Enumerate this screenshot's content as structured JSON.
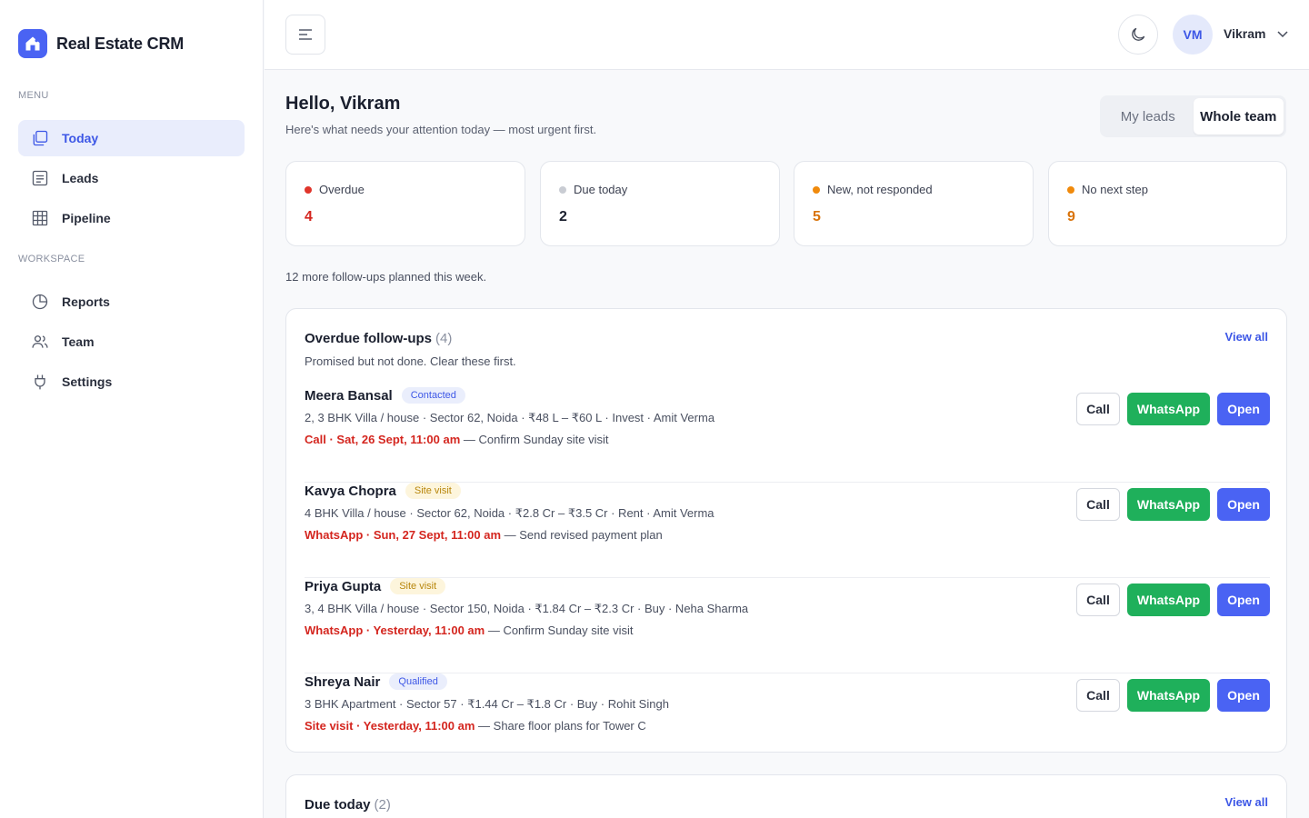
{
  "app": {
    "title": "Real Estate CRM"
  },
  "sidebar": {
    "menu_label": "MENU",
    "workspace_label": "WORKSPACE",
    "menu_items": [
      {
        "label": "Today",
        "icon": "copy-icon",
        "active": true
      },
      {
        "label": "Leads",
        "icon": "list-icon"
      },
      {
        "label": "Pipeline",
        "icon": "table-icon"
      }
    ],
    "workspace_items": [
      {
        "label": "Reports",
        "icon": "pie-chart-icon"
      },
      {
        "label": "Team",
        "icon": "users-icon"
      },
      {
        "label": "Settings",
        "icon": "plug-icon"
      }
    ]
  },
  "topbar": {
    "user_initials": "VM",
    "user_name": "Vikram"
  },
  "header": {
    "greeting": "Hello, Vikram",
    "subtitle": "Here's what needs your attention today — most urgent first.",
    "toggle": {
      "options": [
        "My leads",
        "Whole team"
      ],
      "selected": "Whole team"
    }
  },
  "stats": [
    {
      "label": "Overdue",
      "value": "4",
      "dot_color": "#e0352b",
      "value_color": "#d4261f"
    },
    {
      "label": "Due today",
      "value": "2",
      "dot_color": "#c9ccd3",
      "value_color": "#1a1f2e"
    },
    {
      "label": "New, not responded",
      "value": "5",
      "dot_color": "#f08a0c",
      "value_color": "#d9730a"
    },
    {
      "label": "No next step",
      "value": "9",
      "dot_color": "#f08a0c",
      "value_color": "#d9730a"
    }
  ],
  "more_note": "12 more follow-ups planned this week.",
  "overdue": {
    "title": "Overdue follow-ups",
    "count": "(4)",
    "description": "Promised but not done. Clear these first.",
    "view_all": "View all",
    "leads": [
      {
        "name": "Meera Bansal",
        "status": "Contacted",
        "meta": "2, 3 BHK Villa / house · Sector 62, Noida · ₹48 L – ₹60 L · Invest · Amit Verma",
        "due": "Call · Sat, 26 Sept, 11:00 am",
        "task": " — Confirm Sunday site visit"
      },
      {
        "name": "Kavya Chopra",
        "status": "Site visit",
        "meta": "4 BHK Villa / house · Sector 62, Noida · ₹2.8 Cr – ₹3.5 Cr · Rent · Amit Verma",
        "due": "WhatsApp · Sun, 27 Sept, 11:00 am",
        "task": " — Send revised payment plan"
      },
      {
        "name": "Priya Gupta",
        "status": "Site visit",
        "meta": "3, 4 BHK Villa / house · Sector 150, Noida · ₹1.84 Cr – ₹2.3 Cr · Buy · Neha Sharma",
        "due": "WhatsApp · Yesterday, 11:00 am",
        "task": " — Confirm Sunday site visit"
      },
      {
        "name": "Shreya Nair",
        "status": "Qualified",
        "meta": "3 BHK Apartment · Sector 57 · ₹1.44 Cr – ₹1.8 Cr · Buy · Rohit Singh",
        "due": "Site visit · Yesterday, 11:00 am",
        "task": " — Share floor plans for Tower C"
      }
    ]
  },
  "due_today": {
    "title": "Due today",
    "count": "(2)",
    "view_all": "View all"
  },
  "actions": {
    "call": "Call",
    "whatsapp": "WhatsApp",
    "open": "Open"
  }
}
